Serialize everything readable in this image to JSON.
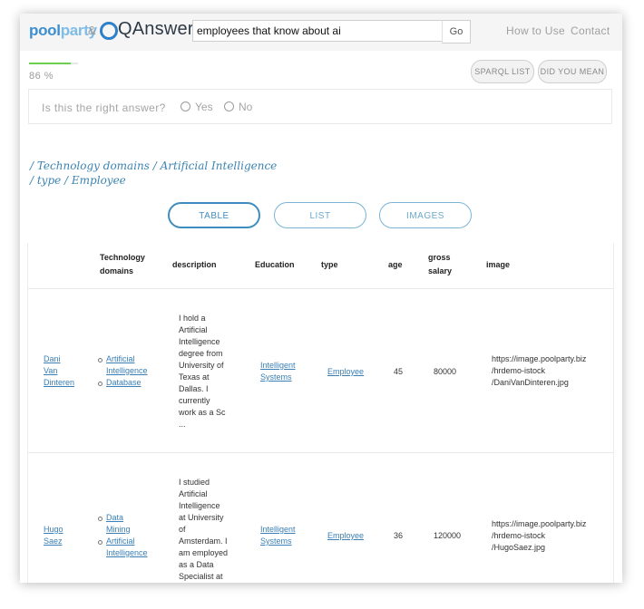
{
  "header": {
    "logo_pool": "pool",
    "logo_party": "party",
    "logo_amp": "&",
    "logo_qanswer": "QAnswer",
    "search_value": "employees that know about ai",
    "go_label": "Go",
    "how_to_use": "How to Use",
    "contact": "Contact"
  },
  "progress": {
    "value_percent": 86,
    "label": "86 %"
  },
  "actions": {
    "sparql_list": "SPARQL LIST",
    "did_you_mean": "DID YOU MEAN"
  },
  "feedback": {
    "question": "Is this the right answer?",
    "yes": "Yes",
    "no": "No"
  },
  "breadcrumb": {
    "line1": "/ Technology domains / Artificial Intelligence",
    "line2": "/ type / Employee"
  },
  "tabs": [
    {
      "label": "TABLE",
      "active": true
    },
    {
      "label": "LIST",
      "active": false
    },
    {
      "label": "IMAGES",
      "active": false
    }
  ],
  "table": {
    "headers": {
      "tech_1": "Technology",
      "tech_2": "domains",
      "description": "description",
      "education": "Education",
      "type": "type",
      "age": "age",
      "salary_1": "gross",
      "salary_2": "salary",
      "image": "image"
    },
    "rows": [
      {
        "name": [
          "Dani",
          "Van",
          "Dinteren"
        ],
        "domains": [
          [
            "Artificial",
            "Intelligence"
          ],
          [
            "Database"
          ]
        ],
        "description": [
          "I hold a",
          "Artificial",
          "Intelligence",
          "degree from",
          "University of",
          "Texas at",
          "Dallas. I",
          "currently",
          "work as a Sc",
          "..."
        ],
        "education": [
          "Intelligent",
          "Systems"
        ],
        "type": "Employee",
        "age": "45",
        "salary": "80000",
        "image": [
          "https://image.poolparty.biz",
          "/hrdemo-istock",
          "/DaniVanDinteren.jpg"
        ]
      },
      {
        "name": [
          "Hugo",
          "Saez"
        ],
        "domains": [
          [
            "Data",
            "Mining"
          ],
          [
            "Artificial",
            "Intelligence"
          ]
        ],
        "description": [
          "I studied",
          "Artificial",
          "Intelligence",
          "at University",
          "of",
          "Amsterdam. I",
          "am employed",
          "as a Data",
          "Specialist at"
        ],
        "education": [
          "Intelligent",
          "Systems"
        ],
        "type": "Employee",
        "age": "36",
        "salary": "120000",
        "image": [
          "https://image.poolparty.biz",
          "/hrdemo-istock",
          "/HugoSaez.jpg"
        ]
      }
    ]
  },
  "colors": {
    "accent": "#3f8dbf",
    "progress": "#6bd04f",
    "link": "#3a7fb5",
    "breadcrumb": "#3c84b2"
  }
}
